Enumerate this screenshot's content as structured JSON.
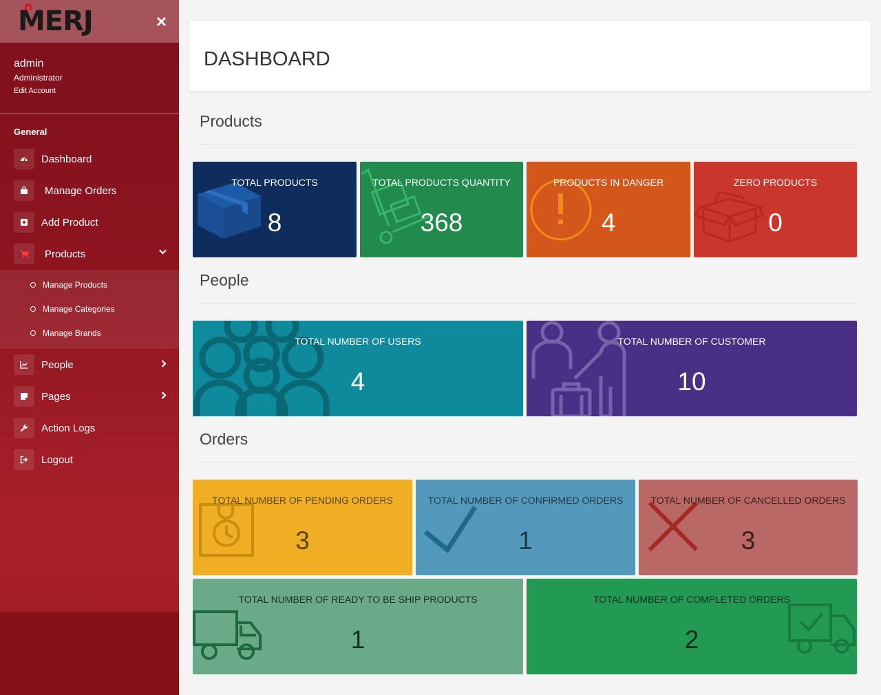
{
  "sidebar": {
    "brand": "MERJ",
    "close_icon": "×",
    "user": {
      "name": "admin",
      "role": "Administrator",
      "edit": "Edit Account"
    },
    "section": "General",
    "items": [
      {
        "label": "Dashboard",
        "icon": "gauge-icon"
      },
      {
        "label": "Manage Orders",
        "icon": "bag-icon"
      },
      {
        "label": "Add Product",
        "icon": "plus-square-icon"
      },
      {
        "label": "Products",
        "icon": "cart-icon",
        "chevron": "⌄"
      },
      {
        "label": "People",
        "icon": "chart-icon",
        "chevron": "›"
      },
      {
        "label": "Pages",
        "icon": "note-icon",
        "chevron": "›"
      },
      {
        "label": "Action Logs",
        "icon": "wrench-icon"
      },
      {
        "label": "Logout",
        "icon": "logout-icon"
      }
    ],
    "products_submenu": [
      "Manage Products",
      "Manage Categories",
      "Manage Brands"
    ]
  },
  "header": {
    "title": "DASHBOARD"
  },
  "sections": {
    "products": "Products",
    "people": "People",
    "orders": "Orders"
  },
  "cards": {
    "total_products": {
      "label": "TOTAL PRODUCTS",
      "value": "8",
      "color": "#0f2d5c",
      "icon": "box-icon"
    },
    "total_quantity": {
      "label": "TOTAL PRODUCTS QUANTITY",
      "value": "368",
      "color": "#218a4c",
      "icon": "hand-truck-icon"
    },
    "in_danger": {
      "label": "PRODUCTS IN DANGER",
      "value": "4",
      "color": "#d3571a",
      "icon": "warning-icon"
    },
    "zero_products": {
      "label": "ZERO PRODUCTS",
      "value": "0",
      "color": "#c9372c",
      "icon": "open-box-icon"
    },
    "users": {
      "label": "TOTAL NUMBER OF USERS",
      "value": "4",
      "color": "#0f8a9c",
      "icon": "users-icon"
    },
    "customers": {
      "label": "TOTAL NUMBER OF CUSTOMER",
      "value": "10",
      "color": "#4a2f87",
      "icon": "travelers-icon"
    },
    "pending": {
      "label": "TOTAL NUMBER OF PENDING ORDERS",
      "value": "3",
      "color": "#f0ae25",
      "icon": "clock-box-icon"
    },
    "confirmed": {
      "label": "TOTAL NUMBER OF CONFIRMED ORDERS",
      "value": "1",
      "color": "#5499bb",
      "icon": "check-icon"
    },
    "cancelled": {
      "label": "TOTAL NUMBER OF CANCELLED ORDERS",
      "value": "3",
      "color": "#b96865",
      "icon": "x-icon"
    },
    "ready_ship": {
      "label": "TOTAL NUMBER OF READY TO BE SHIP PRODUCTS",
      "value": "1",
      "color": "#6aaa88",
      "icon": "truck-icon"
    },
    "completed": {
      "label": "TOTAL NUMBER OF COMPLETED ORDERS",
      "value": "2",
      "color": "#229a54",
      "icon": "truck-check-icon"
    }
  }
}
